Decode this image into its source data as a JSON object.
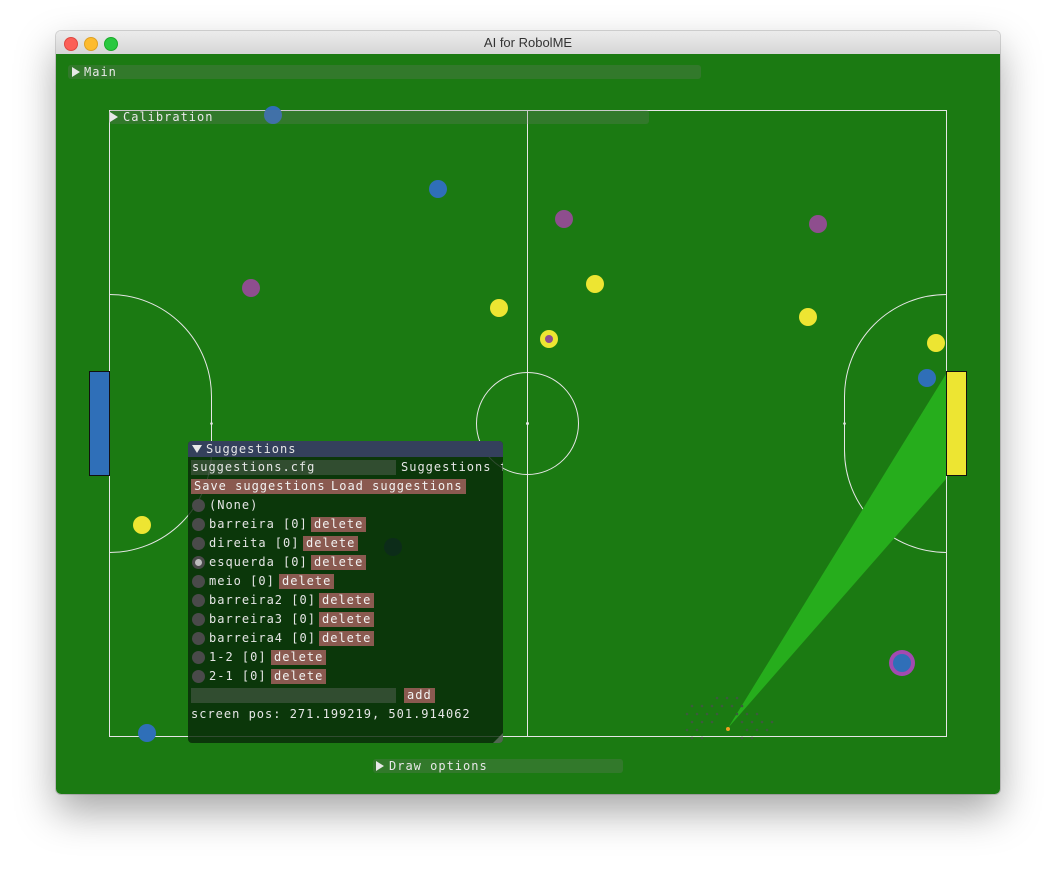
{
  "window": {
    "title": "AI for RobolME"
  },
  "colors": {
    "field": "#1b7a12",
    "blue_team": "#2f6fb8",
    "yellow_team": "#ede532",
    "opponent_marker": "#8e4e8e",
    "button": "#8a5a50"
  },
  "menus": {
    "main": "Main",
    "calibration": "Calibration",
    "draw_options": "Draw options"
  },
  "suggestions": {
    "title": "Suggestions",
    "file_value": "suggestions.cfg",
    "file_label": "Suggestions f",
    "save_label": "Save suggestions",
    "load_label": "Load suggestions",
    "none_label": "(None)",
    "delete_label": "delete",
    "selected_item": "esquerda",
    "items": [
      {
        "label": "barreira [0]"
      },
      {
        "label": "direita [0]"
      },
      {
        "label": "esquerda [0]"
      },
      {
        "label": "meio [0]"
      },
      {
        "label": "barreira2 [0]"
      },
      {
        "label": "barreira3 [0]"
      },
      {
        "label": "barreira4 [0]"
      },
      {
        "label": "1-2 [0]"
      },
      {
        "label": "2-1 [0]"
      }
    ],
    "new_value": "",
    "add_label": "add",
    "screen_pos": "screen pos: 271.199219, 501.914062"
  }
}
